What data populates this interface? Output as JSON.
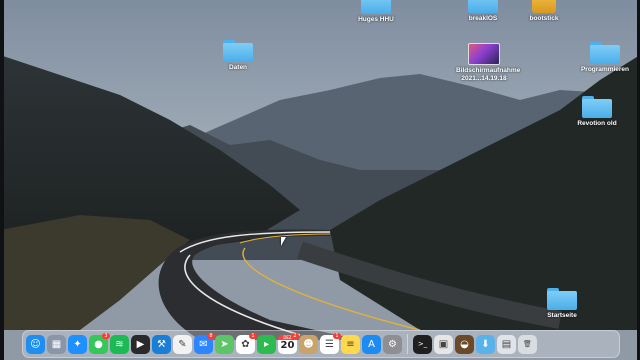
{
  "desktop": {
    "icons": [
      {
        "label": "Huges HHU",
        "kind": "folder"
      },
      {
        "label": "breakIOS",
        "kind": "folder"
      },
      {
        "label": "bootstick",
        "kind": "drive"
      },
      {
        "label": "Daten",
        "kind": "folder"
      },
      {
        "label": "Bildschirmaufnahme 2021...14.19.18",
        "kind": "screenshot"
      },
      {
        "label": "Programmieren",
        "kind": "folder"
      },
      {
        "label": "Revotion old",
        "kind": "folder"
      },
      {
        "label": "Startseite",
        "kind": "folder"
      }
    ]
  },
  "dock": {
    "apps": [
      {
        "name": "finder-icon",
        "glyph": "☺",
        "color": "#1e8ef0"
      },
      {
        "name": "launchpad-icon",
        "glyph": "▦",
        "color": "#8a96a8"
      },
      {
        "name": "safari-icon",
        "glyph": "✦",
        "color": "#1e90ff"
      },
      {
        "name": "messages-icon",
        "glyph": "●",
        "color": "#34c759",
        "badge": "3"
      },
      {
        "name": "spotify-icon",
        "glyph": "≋",
        "color": "#1db954"
      },
      {
        "name": "final-cut-icon",
        "glyph": "▶",
        "color": "#2a2a2a"
      },
      {
        "name": "xcode-icon",
        "glyph": "⚒",
        "color": "#1a7ed6"
      },
      {
        "name": "mindnode-icon",
        "glyph": "✎",
        "color": "#f2f2f2"
      },
      {
        "name": "mail-icon",
        "glyph": "✉",
        "color": "#2e86ff",
        "badge": "8"
      },
      {
        "name": "maps-icon",
        "glyph": "➤",
        "color": "#5ec46a"
      },
      {
        "name": "photos-icon",
        "glyph": "✿",
        "color": "#ffffff",
        "badge": "1"
      },
      {
        "name": "facetime-icon",
        "glyph": "▸",
        "color": "#2dbb4f"
      },
      {
        "name": "calendar-icon",
        "glyph": "",
        "color": "#ffffff",
        "badge": "2",
        "month": "DEZ",
        "day": "20"
      },
      {
        "name": "contacts-icon",
        "glyph": "☻",
        "color": "#c9a36a"
      },
      {
        "name": "reminders-icon",
        "glyph": "☰",
        "color": "#ffffff",
        "badge": "1"
      },
      {
        "name": "notes-icon",
        "glyph": "≡",
        "color": "#ffd84d"
      },
      {
        "name": "app-store-icon",
        "glyph": "A",
        "color": "#1c8cf2"
      },
      {
        "name": "system-preferences-icon",
        "glyph": "⚙",
        "color": "#8e8e93"
      },
      {
        "name": "terminal-icon",
        "glyph": ">_",
        "color": "#1f1f1f"
      },
      {
        "name": "preview-icon",
        "glyph": "▣",
        "color": "#e6e6e6"
      },
      {
        "name": "coconut-battery-icon",
        "glyph": "◒",
        "color": "#6b4a2b"
      },
      {
        "name": "downloads-icon",
        "glyph": "⬇",
        "color": "#5ab2ea"
      },
      {
        "name": "screenshots-stack-icon",
        "glyph": "▤",
        "color": "#dfe4ea"
      },
      {
        "name": "trash-icon",
        "glyph": "🗑",
        "color": "#d8dde2"
      }
    ]
  }
}
